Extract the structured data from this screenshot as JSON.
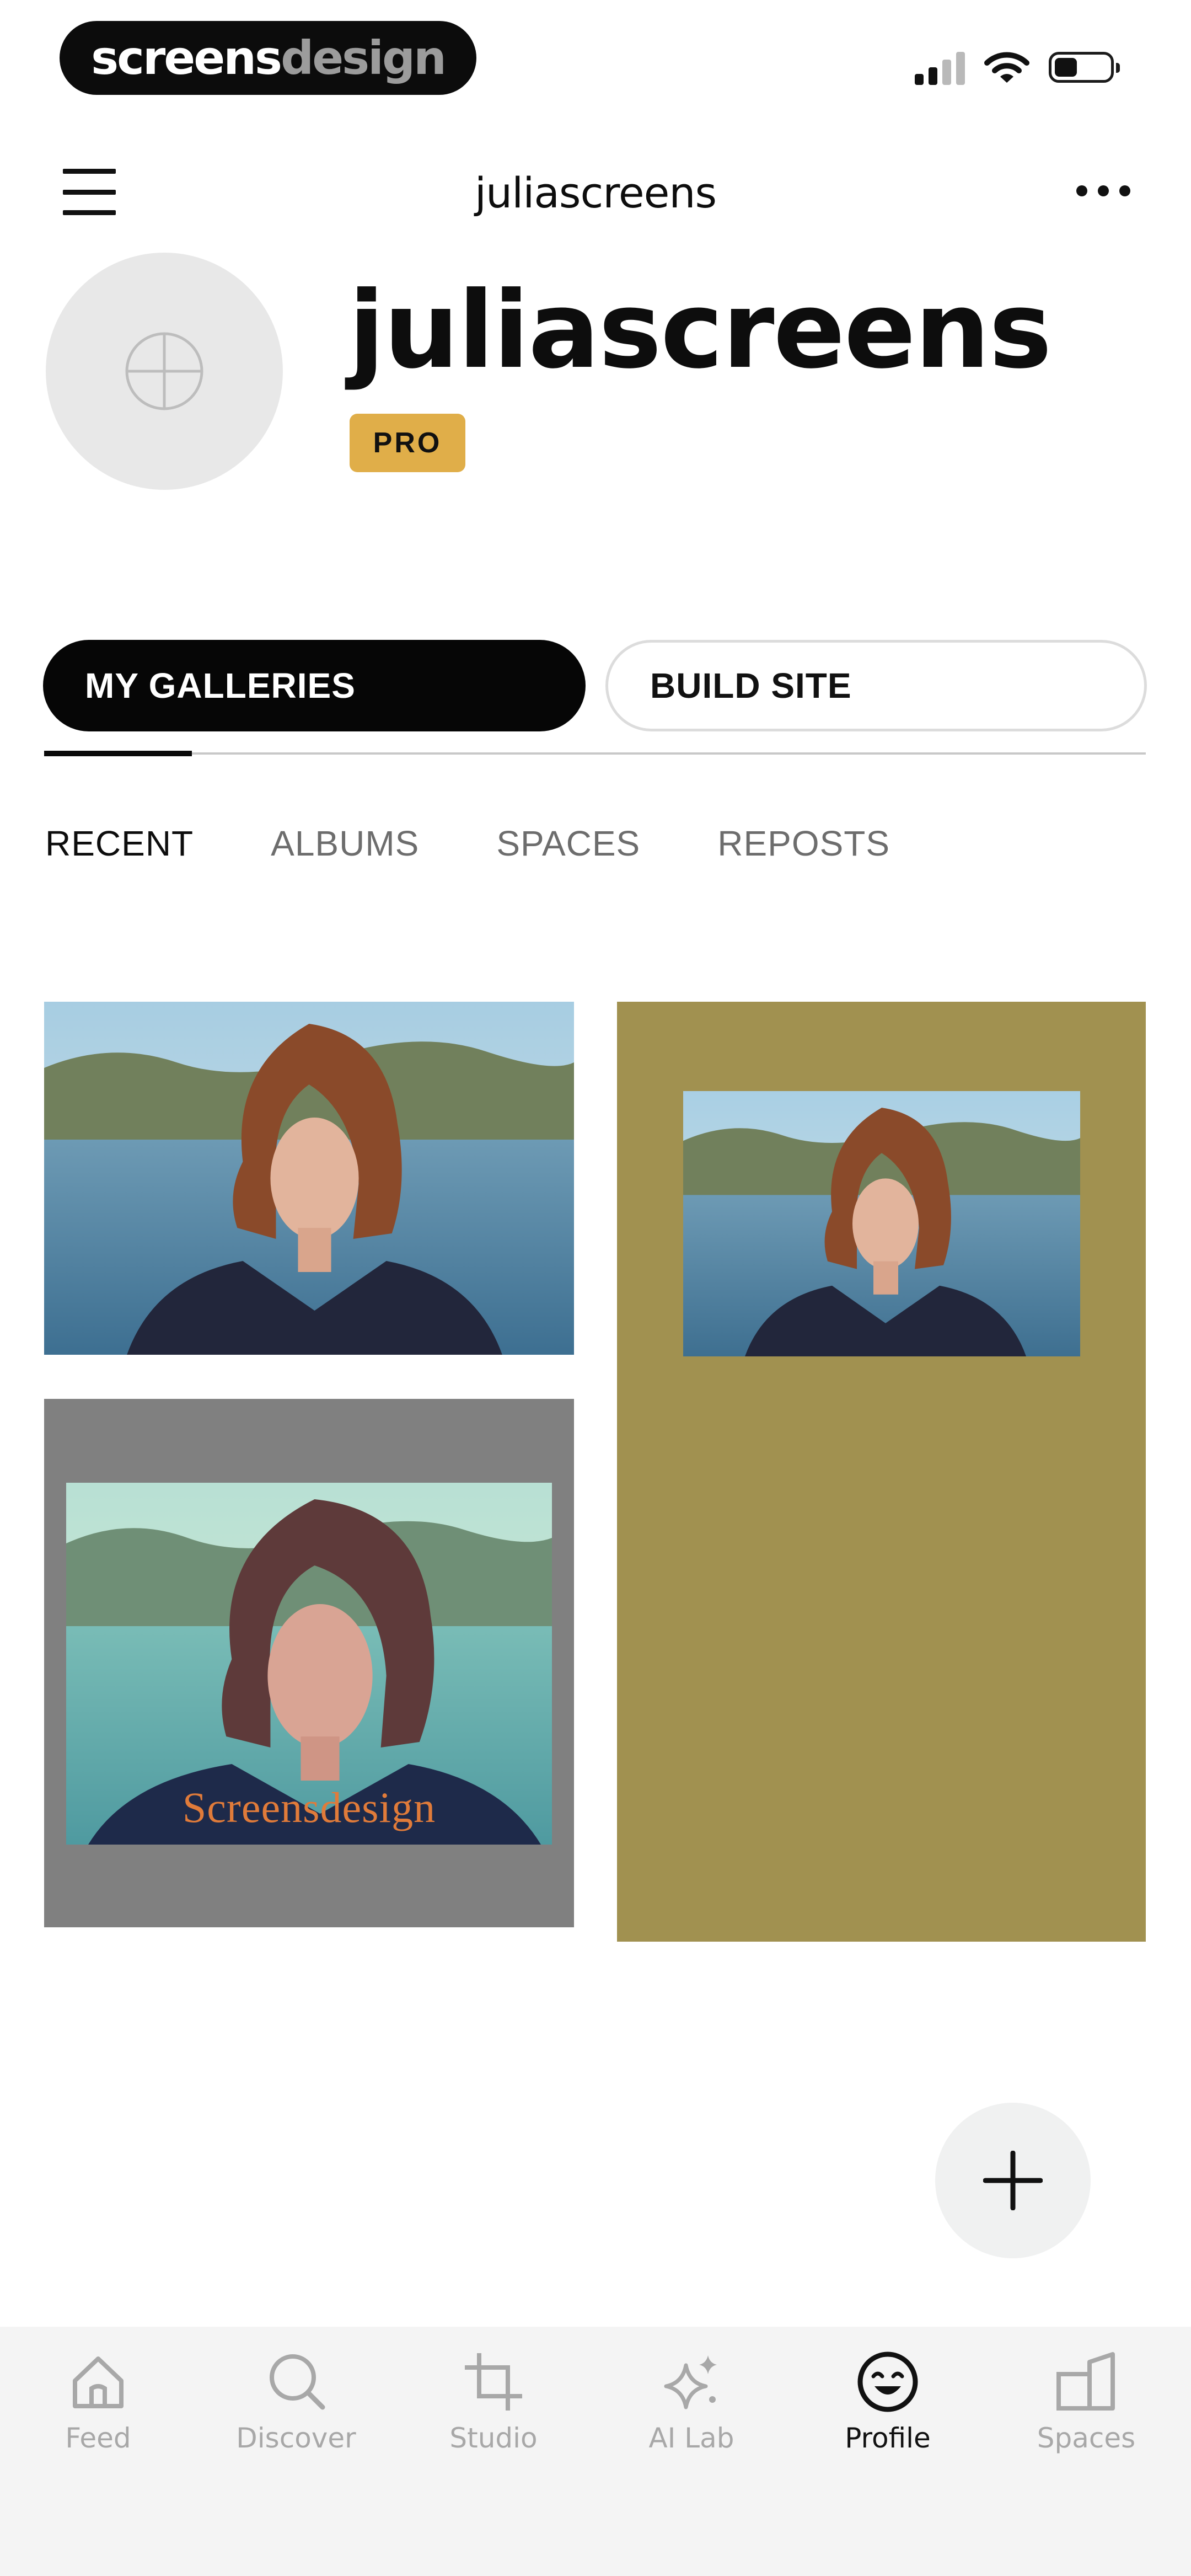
{
  "status_bar": {
    "brand_part1": "screens",
    "brand_part2": "design"
  },
  "header": {
    "title": "juliascreens"
  },
  "profile": {
    "username": "juliascreens",
    "badge": "PRO"
  },
  "segments": [
    {
      "label": "MY GALLERIES",
      "active": true
    },
    {
      "label": "BUILD SITE",
      "active": false
    }
  ],
  "tabs": [
    {
      "label": "RECENT",
      "active": true
    },
    {
      "label": "ALBUMS",
      "active": false
    },
    {
      "label": "SPACES",
      "active": false
    },
    {
      "label": "REPOSTS",
      "active": false
    }
  ],
  "gallery": {
    "items": [
      {
        "kind": "portrait-photo",
        "background": "#ffffff"
      },
      {
        "kind": "portrait-photo-on-color",
        "background": "#a19150"
      },
      {
        "kind": "portrait-photo-watermarked",
        "background": "#808080",
        "watermark": "Screensdesign"
      }
    ]
  },
  "colors": {
    "accent_black": "#060606",
    "pro_badge": "#e0ae49",
    "inactive_text": "#6d6d6d",
    "tabbar_inactive": "#a8a8a8"
  },
  "bottom_nav": [
    {
      "label": "Feed",
      "icon": "home-icon",
      "active": false
    },
    {
      "label": "Discover",
      "icon": "search-icon",
      "active": false
    },
    {
      "label": "Studio",
      "icon": "crop-icon",
      "active": false
    },
    {
      "label": "AI Lab",
      "icon": "sparkles-icon",
      "active": false
    },
    {
      "label": "Profile",
      "icon": "smiley-icon",
      "active": true
    },
    {
      "label": "Spaces",
      "icon": "spaces-icon",
      "active": false
    }
  ]
}
